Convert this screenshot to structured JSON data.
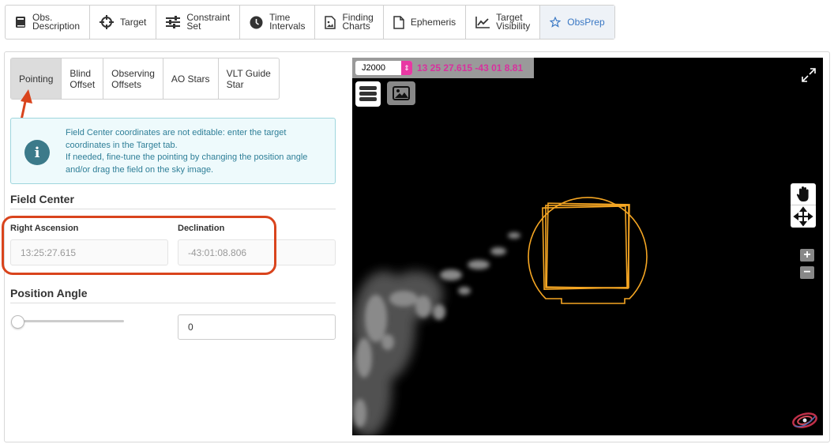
{
  "toolbar": {
    "items": [
      {
        "label": "Obs.\nDescription",
        "icon": "book-icon"
      },
      {
        "label": "Target",
        "icon": "crosshair-icon"
      },
      {
        "label": "Constraint\nSet",
        "icon": "sliders-icon"
      },
      {
        "label": "Time\nIntervals",
        "icon": "clock-icon"
      },
      {
        "label": "Finding\nCharts",
        "icon": "image-file-icon"
      },
      {
        "label": "Ephemeris",
        "icon": "file-icon"
      },
      {
        "label": "Target\nVisibility",
        "icon": "chart-line-icon"
      },
      {
        "label": "ObsPrep",
        "icon": "star-icon"
      }
    ],
    "active": "ObsPrep"
  },
  "subtabs": {
    "items": [
      "Pointing",
      "Blind\nOffset",
      "Observing\nOffsets",
      "AO Stars",
      "VLT Guide\nStar"
    ],
    "active": "Pointing"
  },
  "info": {
    "line1": "Field Center coordinates are not editable: enter the target coordinates in the Target tab.",
    "line2": "If needed, fine-tune the pointing by changing the position angle and/or drag the field on the sky image."
  },
  "field_center": {
    "title": "Field Center",
    "ra_label": "Right Ascension",
    "ra_value": "13:25:27.615",
    "dec_label": "Declination",
    "dec_value": "-43:01:08.806"
  },
  "position_angle": {
    "title": "Position Angle",
    "value": "0",
    "slider_fraction": 0
  },
  "viewer": {
    "frame": "J2000",
    "coords": "13 25 27.615 -43 01 8.81",
    "colors": {
      "overlay": "#f5a623",
      "coord_text": "#d8309e"
    }
  },
  "colors": {
    "accent": "#3a78c4",
    "highlight": "#d9441d",
    "info_text": "#2f7f98"
  }
}
